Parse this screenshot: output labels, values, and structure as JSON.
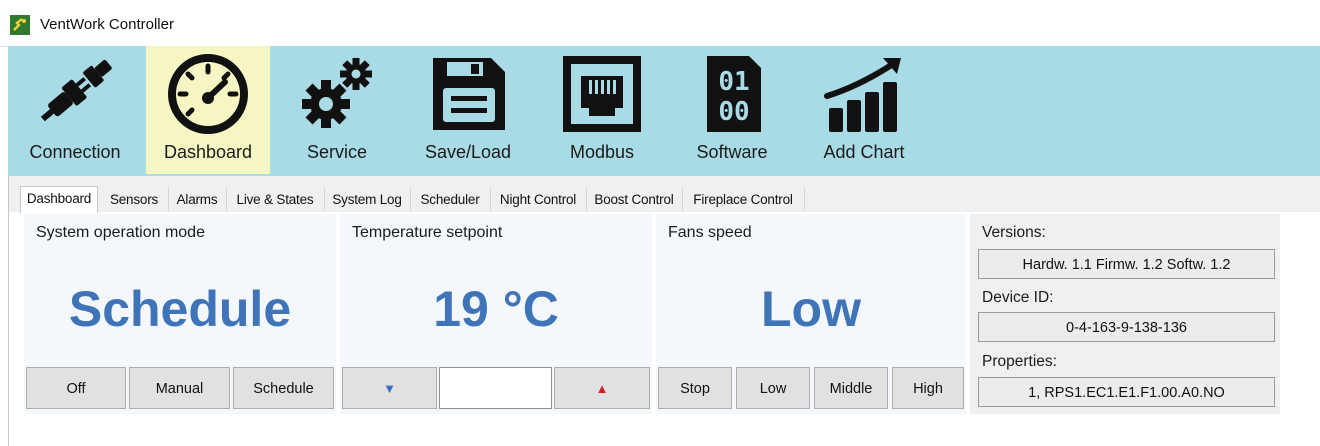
{
  "window": {
    "title": "VentWork Controller",
    "app_icon": "ventwork-app-icon"
  },
  "ribbon": {
    "background": "#a8dbe5",
    "active_background": "#f6f6c5",
    "items": [
      {
        "label": "Connection",
        "icon": "plug-icon"
      },
      {
        "label": "Dashboard",
        "icon": "gauge-icon",
        "active": true
      },
      {
        "label": "Service",
        "icon": "gears-icon"
      },
      {
        "label": "Save/Load",
        "icon": "floppy-disk-icon"
      },
      {
        "label": "Modbus",
        "icon": "ethernet-port-icon"
      },
      {
        "label": "Software",
        "icon": "binary-icon"
      },
      {
        "label": "Add Chart",
        "icon": "bar-chart-icon"
      }
    ]
  },
  "tabs": [
    {
      "label": "Dashboard",
      "active": true
    },
    {
      "label": "Sensors"
    },
    {
      "label": "Alarms"
    },
    {
      "label": "Live & States"
    },
    {
      "label": "System Log"
    },
    {
      "label": "Scheduler"
    },
    {
      "label": "Night Control"
    },
    {
      "label": "Boost Control"
    },
    {
      "label": "Fireplace Control"
    }
  ],
  "operation_mode": {
    "title": "System operation mode",
    "value": "Schedule",
    "buttons": [
      "Off",
      "Manual",
      "Schedule"
    ]
  },
  "temperature": {
    "title": "Temperature setpoint",
    "value": "19 °C",
    "down_glyph": "▼",
    "up_glyph": "▲",
    "input_value": ""
  },
  "fans": {
    "title": "Fans speed",
    "value": "Low",
    "buttons": [
      "Stop",
      "Low",
      "Middle",
      "High"
    ]
  },
  "info": {
    "versions_label": "Versions:",
    "versions_value": "Hardw. 1.1 Firmw. 1.2 Softw. 1.2",
    "device_id_label": "Device ID:",
    "device_id_value": "0-4-163-9-138-136",
    "properties_label": "Properties:",
    "properties_value": "1, RPS1.EC1.E1.F1.00.A0.NO"
  },
  "colors": {
    "value_text": "#3f75b8",
    "arrow_down": "#3a6fc0",
    "arrow_up": "#d42020"
  }
}
